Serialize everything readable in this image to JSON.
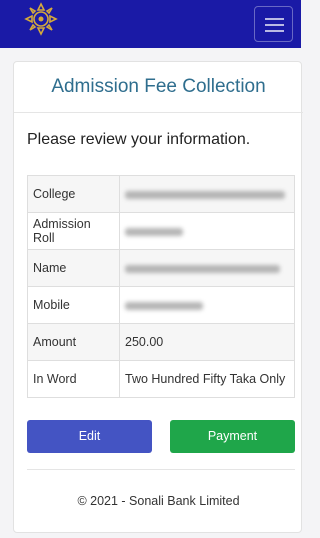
{
  "header": {
    "logo_icon": "bank-emblem-icon",
    "menu_icon": "hamburger-menu-icon",
    "colors": {
      "navbar": "#1a1aa6",
      "logo": "#d4a93c"
    }
  },
  "page": {
    "title": "Admission Fee Collection",
    "subtitle": "Please review your information."
  },
  "info": {
    "rows": [
      {
        "label": "College",
        "value": "",
        "redacted": true
      },
      {
        "label": "Admission Roll",
        "value": "",
        "redacted": true
      },
      {
        "label": "Name",
        "value": "",
        "redacted": true
      },
      {
        "label": "Mobile",
        "value": "",
        "redacted": true
      },
      {
        "label": "Amount",
        "value": "250.00",
        "redacted": false
      },
      {
        "label": "In Word",
        "value": "Two Hundred Fifty Taka Only",
        "redacted": false
      }
    ]
  },
  "actions": {
    "edit_label": "Edit",
    "payment_label": "Payment",
    "colors": {
      "edit": "#4454c3",
      "payment": "#1fa64a"
    }
  },
  "footer": {
    "text": "© 2021 - Sonali Bank Limited"
  }
}
